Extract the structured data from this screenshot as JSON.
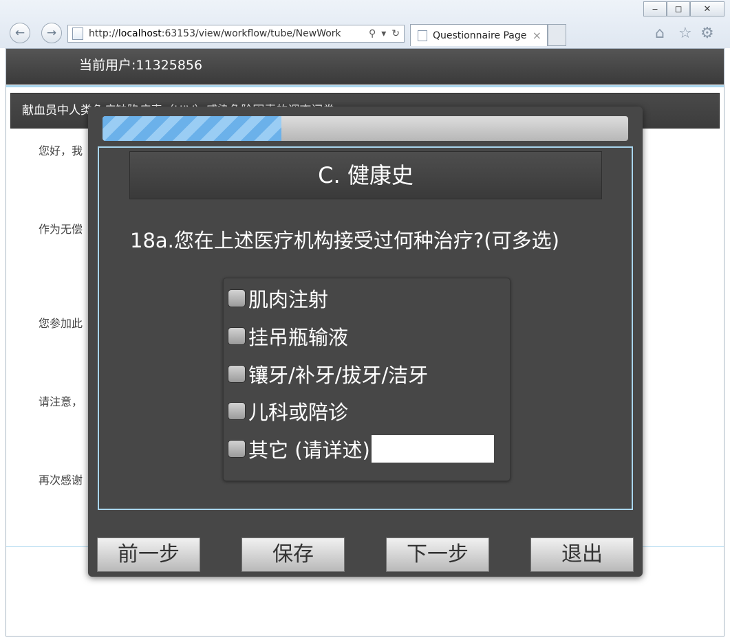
{
  "browser": {
    "url_prefix": "http://",
    "url_host": "localhost",
    "url_rest": ":63153/view/workflow/tube/NewWork",
    "tab_title": "Questionnaire Page",
    "tab_close": "×",
    "minimize": "‒",
    "maximize": "◻",
    "close": "✕",
    "back": "←",
    "forward": "→",
    "search_glyph": "⚲",
    "dropdown_glyph": "▾",
    "refresh_glyph": "↻",
    "home_glyph": "⌂",
    "star_glyph": "☆",
    "gear_glyph": "⚙"
  },
  "header": {
    "current_user": "当前用户:11325856"
  },
  "survey": {
    "title": "献血员中人类免疫缺陷病毒（HIV）感染危险因素的调查问卷",
    "intro_paragraphs": [
      "您好，我",
      "作为无偿",
      "您参加此",
      "请注意，",
      "再次感谢"
    ]
  },
  "modal": {
    "progress_fraction": 0.34,
    "section_title": "C. 健康史",
    "question": "18a.您在上述医疗机构接受过何种治疗?(可多选)",
    "options": [
      "肌肉注射",
      "挂吊瓶输液",
      "镶牙/补牙/拔牙/洁牙",
      "儿科或陪诊",
      "其它 (请详述)"
    ],
    "other_input_value": "",
    "buttons": {
      "prev": "前一步",
      "save": "保存",
      "next": "下一步",
      "exit": "退出"
    }
  },
  "colors": {
    "modal_bg": "#474747",
    "progress_fill": "#6bb1ea",
    "panel_border": "#a9d6ee"
  }
}
